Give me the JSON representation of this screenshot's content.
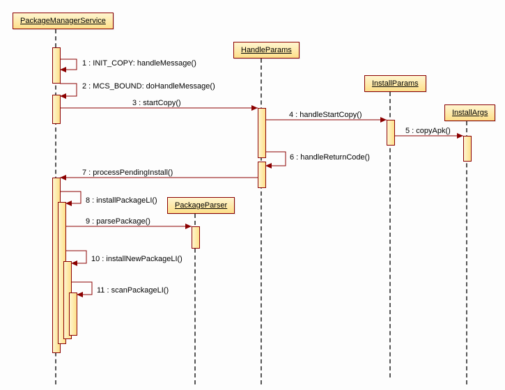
{
  "actors": {
    "pms": "PackageManagerService",
    "handleParams": "HandleParams",
    "packageParser": "PackageParser",
    "installParams": "InstallParams",
    "installArgs": "InstallArgs"
  },
  "messages": {
    "m1": "1 : INIT_COPY: handleMessage()",
    "m2": "2 : MCS_BOUND: doHandleMessage()",
    "m3": "3 : startCopy()",
    "m4": "4 : handleStartCopy()",
    "m5": "5 : copyApk()",
    "m6": "6 : handleReturnCode()",
    "m7": "7 : processPendingInstall()",
    "m8": "8 : installPackageLI()",
    "m9": "9 : parsePackage()",
    "m10": "10 : installNewPackageLI()",
    "m11": "11 : scanPackageLI()"
  },
  "chart_data": {
    "type": "sequence-diagram",
    "participants": [
      "PackageManagerService",
      "HandleParams",
      "PackageParser",
      "InstallParams",
      "InstallArgs"
    ],
    "messages": [
      {
        "n": 1,
        "from": "PackageManagerService",
        "to": "PackageManagerService",
        "label": "INIT_COPY: handleMessage()"
      },
      {
        "n": 2,
        "from": "PackageManagerService",
        "to": "PackageManagerService",
        "label": "MCS_BOUND: doHandleMessage()"
      },
      {
        "n": 3,
        "from": "PackageManagerService",
        "to": "HandleParams",
        "label": "startCopy()"
      },
      {
        "n": 4,
        "from": "HandleParams",
        "to": "InstallParams",
        "label": "handleStartCopy()"
      },
      {
        "n": 5,
        "from": "InstallParams",
        "to": "InstallArgs",
        "label": "copyApk()"
      },
      {
        "n": 6,
        "from": "HandleParams",
        "to": "HandleParams",
        "label": "handleReturnCode()"
      },
      {
        "n": 7,
        "from": "HandleParams",
        "to": "PackageManagerService",
        "label": "processPendingInstall()"
      },
      {
        "n": 8,
        "from": "PackageManagerService",
        "to": "PackageManagerService",
        "label": "installPackageLI()"
      },
      {
        "n": 9,
        "from": "PackageManagerService",
        "to": "PackageParser",
        "label": "parsePackage()"
      },
      {
        "n": 10,
        "from": "PackageManagerService",
        "to": "PackageManagerService",
        "label": "installNewPackageLI()"
      },
      {
        "n": 11,
        "from": "PackageManagerService",
        "to": "PackageManagerService",
        "label": "scanPackageLI()"
      }
    ]
  }
}
